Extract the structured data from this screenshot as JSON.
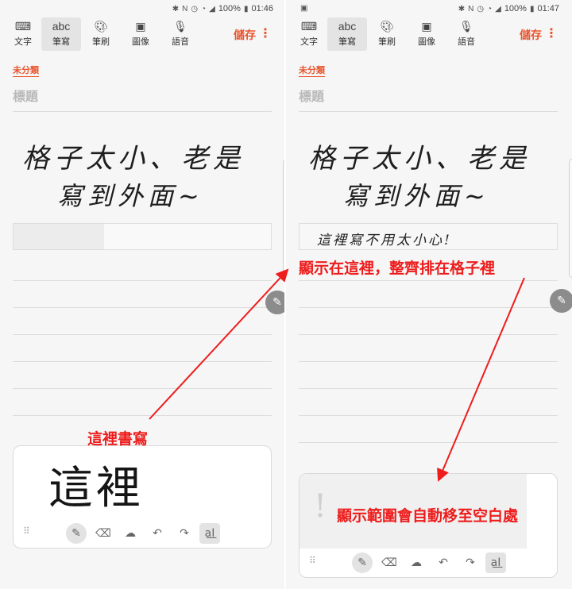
{
  "left": {
    "status": {
      "time": "01:46",
      "battery": "100%"
    },
    "toolbar": {
      "items": [
        {
          "icon": "keyboard-icon",
          "label": "文字"
        },
        {
          "icon": "abc",
          "label": "筆寫"
        },
        {
          "icon": "palette-icon",
          "label": "筆刷"
        },
        {
          "icon": "image-icon",
          "label": "圖像"
        },
        {
          "icon": "mic-icon",
          "label": "語音"
        }
      ],
      "save_label": "儲存"
    },
    "category": "未分類",
    "title_placeholder": "標題",
    "handwriting_line1": "格子太小、老是",
    "handwriting_line2": "寫到外面∼",
    "input_handwriting": "這裡"
  },
  "right": {
    "status": {
      "time": "01:47",
      "battery": "100%"
    },
    "toolbar": {
      "items": [
        {
          "icon": "keyboard-icon",
          "label": "文字"
        },
        {
          "icon": "abc",
          "label": "筆寫"
        },
        {
          "icon": "palette-icon",
          "label": "筆刷"
        },
        {
          "icon": "image-icon",
          "label": "圖像"
        },
        {
          "icon": "mic-icon",
          "label": "語音"
        }
      ],
      "save_label": "儲存"
    },
    "category": "未分類",
    "title_placeholder": "標題",
    "handwriting_line1": "格子太小、老是",
    "handwriting_line2": "寫到外面∼",
    "typed_text": "這裡寫不用太小心!"
  },
  "annotations": {
    "write_here": "這裡書寫",
    "shown_here": "顯示在這裡，整齊排在格子裡",
    "auto_move": "顯示範圍會自動移至空白處"
  },
  "colors": {
    "accent": "#e8552e",
    "annotation": "#ee1c1c"
  }
}
